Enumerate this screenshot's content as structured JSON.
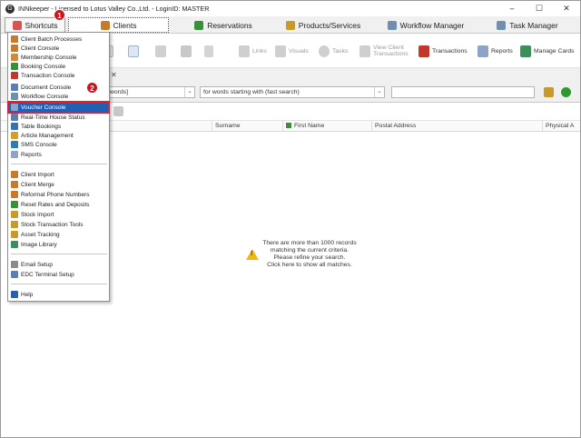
{
  "window": {
    "title": "INNkeeper - Licensed to Lotus Valley Co.,Ltd. - LoginID: MASTER",
    "app_icon": "G",
    "controls": {
      "minimize": "–",
      "maximize": "☐",
      "close": "✕"
    }
  },
  "tabs": [
    {
      "label": "Shortcuts",
      "icon": "shortcuts-icon",
      "color": "#d9534f"
    },
    {
      "label": "Clients",
      "icon": "clients-icon",
      "color": "#c8792a"
    },
    {
      "label": "Reservations",
      "icon": "reservations-icon",
      "color": "#3a8f3a"
    },
    {
      "label": "Products/Services",
      "icon": "products-icon",
      "color": "#c89a2a"
    },
    {
      "label": "Workflow Manager",
      "icon": "workflow-icon",
      "color": "#6f8fb0"
    },
    {
      "label": "Task Manager",
      "icon": "task-icon",
      "color": "#6f8fb0"
    }
  ],
  "toolbar": {
    "links": "Links",
    "visuals": "Visuals",
    "tasks": "Tasks",
    "view_client_transactions_1": "View Client",
    "view_client_transactions_2": "Transactions",
    "transactions": "Transactions",
    "reports": "Reports",
    "manage_cards": "Manage Cards"
  },
  "search": {
    "field_combo": "words]",
    "mode_combo": "for words starting with (fast search)",
    "dropdown_arrow": "⌄"
  },
  "grid": {
    "columns": [
      "Surname",
      "First Name",
      "Postal Address",
      "Physical A"
    ]
  },
  "notice": {
    "line1": "There are more than 1000 records",
    "line2": "matching the current criteria.",
    "line3": "Please refine your search.",
    "line4": "Click here to show all matches."
  },
  "shortcuts_menu": {
    "group1": [
      {
        "label": "Client Batch Processes",
        "color": "#c8792a"
      },
      {
        "label": "Client Console",
        "color": "#c8792a"
      },
      {
        "label": "Membership Console",
        "color": "#d08a3a"
      },
      {
        "label": "Booking Console",
        "color": "#3a8f3a"
      },
      {
        "label": "Transaction Console",
        "color": "#c0392b"
      },
      {
        "label": "Document Console",
        "color": "#5a7fb0"
      },
      {
        "label": "Workflow Console",
        "color": "#6f8fb0"
      },
      {
        "label": "Voucher Console",
        "color": "#8fa3c7"
      },
      {
        "label": "Real-Time House Status",
        "color": "#5a7fb0"
      },
      {
        "label": "Table Bookings",
        "color": "#3a6fb0"
      },
      {
        "label": "Article Management",
        "color": "#d0a02a"
      },
      {
        "label": "SMS Console",
        "color": "#2a7fb0"
      },
      {
        "label": "Reports",
        "color": "#8fa3c7"
      }
    ],
    "group2": [
      {
        "label": "Client Import",
        "color": "#c8792a"
      },
      {
        "label": "Client Merge",
        "color": "#c8792a"
      },
      {
        "label": "Reformat Phone Numbers",
        "color": "#c8792a"
      },
      {
        "label": "Reset Rates and Deposits",
        "color": "#3a8f3a"
      },
      {
        "label": "Stock Import",
        "color": "#c89a2a"
      },
      {
        "label": "Stock Transaction Tools",
        "color": "#c89a2a"
      },
      {
        "label": "Asset Tracking",
        "color": "#c89a2a"
      },
      {
        "label": "Image Library",
        "color": "#3a8f5a"
      }
    ],
    "group3": [
      {
        "label": "Email Setup",
        "color": "#8a8a8a"
      },
      {
        "label": "EDC Terminal Setup",
        "color": "#5a7fb0"
      }
    ],
    "group4": [
      {
        "label": "Help",
        "color": "#2a5fb0"
      }
    ],
    "selected_item": "Voucher Console"
  },
  "callouts": {
    "one": "1",
    "two": "2"
  },
  "colors": {
    "selection": "#1f5fb5",
    "highlight_border": "#e0202a",
    "badge": "#c8161d",
    "warning": "#f2b711",
    "go_button": "#2e9a2e"
  }
}
